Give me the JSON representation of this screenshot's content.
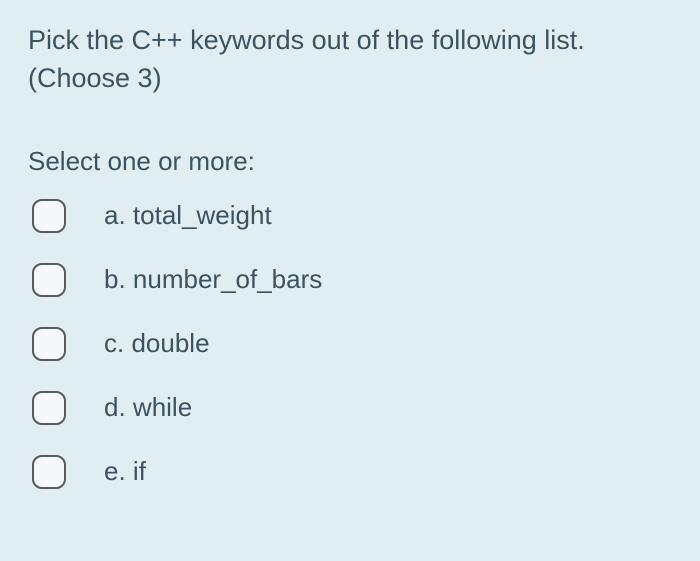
{
  "question": "Pick the C++ keywords out of the following list. (Choose 3)",
  "instruction": "Select one or more:",
  "options": [
    {
      "letter": "a.",
      "text": "total_weight"
    },
    {
      "letter": "b.",
      "text": "number_of_bars"
    },
    {
      "letter": "c.",
      "text": "double"
    },
    {
      "letter": "d.",
      "text": "while"
    },
    {
      "letter": "e.",
      "text": "if"
    }
  ]
}
